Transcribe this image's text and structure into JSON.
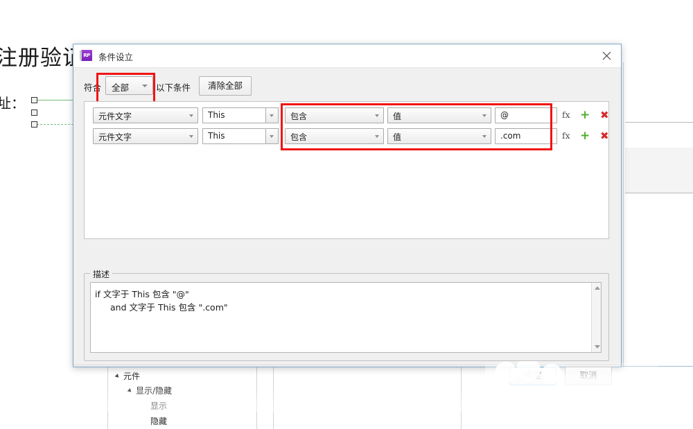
{
  "background": {
    "page_title": "注册验证",
    "field_label": "址：",
    "tree": {
      "root": "元件",
      "child": "显示/隐藏",
      "leaf_1": "显示",
      "leaf_2": "隐藏"
    }
  },
  "dialog": {
    "title": "条件设立",
    "icon": "rp-app-icon",
    "close_icon": "close-icon",
    "match": {
      "prefix_label": "符合",
      "selected": "全部",
      "suffix_label": "以下条件",
      "clear_all_label": "清除全部"
    },
    "conditions": [
      {
        "subject": "元件文字",
        "target": "This",
        "operator": "包含",
        "value_type": "值",
        "value": "@",
        "fx_label": "fx",
        "add_label": "+",
        "delete_label": "✖"
      },
      {
        "subject": "元件文字",
        "target": "This",
        "operator": "包含",
        "value_type": "值",
        "value": ".com",
        "fx_label": "fx",
        "add_label": "+",
        "delete_label": "✖"
      }
    ],
    "description": {
      "legend": "描述",
      "line_1": "if 文字于 This 包含 \"@\"",
      "line_2": "and 文字于 This 包含 \".com\""
    },
    "footer": {
      "ok_label": "确定",
      "cancel_label": "取消"
    }
  },
  "annotations": {
    "highlight_color": "#f01414",
    "boxes": [
      "match-type-dropdown",
      "operator-value-group"
    ]
  }
}
